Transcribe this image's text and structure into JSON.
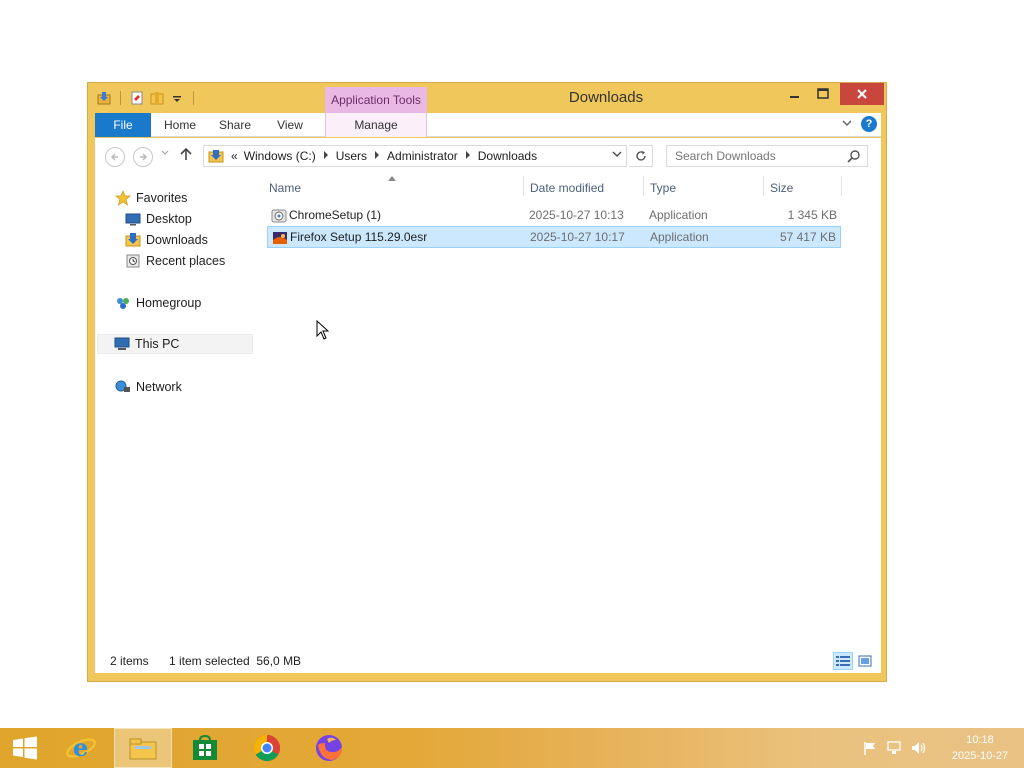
{
  "window": {
    "title": "Downloads",
    "context_tab_header": "Application Tools",
    "accent": "#f0c75a"
  },
  "ribbon": {
    "tabs": {
      "file": "File",
      "home": "Home",
      "share": "Share",
      "view": "View",
      "manage": "Manage"
    },
    "help_label": "?"
  },
  "address": {
    "overflow": "«",
    "crumbs": [
      "Windows (C:)",
      "Users",
      "Administrator",
      "Downloads"
    ]
  },
  "search": {
    "placeholder": "Search Downloads"
  },
  "nav": {
    "favorites": "Favorites",
    "desktop": "Desktop",
    "downloads": "Downloads",
    "recent": "Recent places",
    "homegroup": "Homegroup",
    "thispc": "This PC",
    "network": "Network"
  },
  "columns": {
    "name": "Name",
    "date": "Date modified",
    "type": "Type",
    "size": "Size"
  },
  "files": [
    {
      "name": "ChromeSetup (1)",
      "date": "2025-10-27 10:13",
      "type": "Application",
      "size": "1 345 KB",
      "icon": "chrome-setup-icon",
      "selected": false
    },
    {
      "name": "Firefox Setup 115.29.0esr",
      "date": "2025-10-27 10:17",
      "type": "Application",
      "size": "57 417 KB",
      "icon": "firefox-setup-icon",
      "selected": true
    }
  ],
  "status": {
    "count": "2 items",
    "selection": "1 item selected  56,0 MB"
  },
  "taskbar": {
    "time": "10:18",
    "date": "2025-10-27"
  }
}
